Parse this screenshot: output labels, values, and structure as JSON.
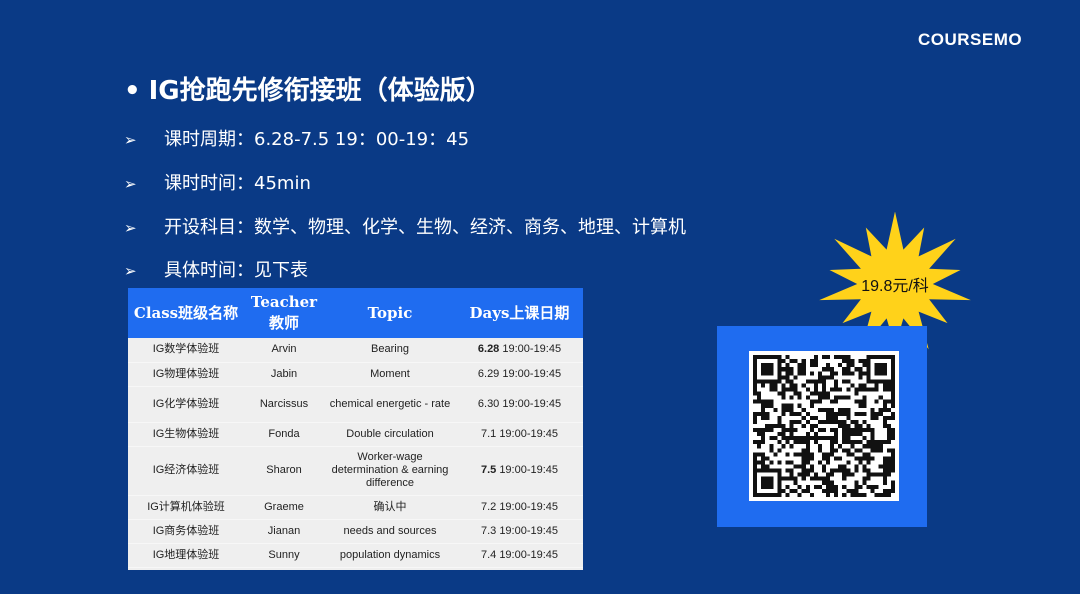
{
  "logo": {
    "text": "COURSEMO"
  },
  "title": {
    "bullet": "•",
    "text": "IG抢跑先修衔接班（体验版）"
  },
  "info": [
    {
      "arrow": "➢",
      "text": "课时周期：6.28-7.5 19：00-19：45"
    },
    {
      "arrow": "➢",
      "text": "课时时间：45min"
    },
    {
      "arrow": "➢",
      "text": "开设科目：数学、物理、化学、生物、经济、商务、地理、计算机"
    },
    {
      "arrow": "➢",
      "text": "具体时间：见下表"
    }
  ],
  "table": {
    "headers": [
      "Class班级名称",
      "Teacher教师",
      "Topic",
      "Days上课日期"
    ],
    "rows": [
      {
        "cls": "IG数学体验班",
        "teacher": "Arvin",
        "topic": "Bearing",
        "date": "6.28",
        "time": "19:00-19:45",
        "date_bold": true
      },
      {
        "cls": "IG物理体验班",
        "teacher": "Jabin",
        "topic": "Moment",
        "date": "6.29",
        "time": "19:00-19:45",
        "date_bold": false
      },
      {
        "cls": "IG化学体验班",
        "teacher": "Narcissus",
        "topic": "chemical energetic - rate",
        "date": "6.30",
        "time": "19:00-19:45",
        "date_bold": false
      },
      {
        "cls": "IG生物体验班",
        "teacher": "Fonda",
        "topic": "Double circulation",
        "date": "7.1",
        "time": "19:00-19:45",
        "date_bold": false
      },
      {
        "cls": "IG经济体验班",
        "teacher": "Sharon",
        "topic": "Worker-wage determination & earning difference",
        "date": "7.5",
        "time": "19:00-19:45",
        "date_bold": true
      },
      {
        "cls": "IG计算机体验班",
        "teacher": "Graeme",
        "topic": "确认中",
        "date": "7.2",
        "time": "19:00-19:45",
        "date_bold": false
      },
      {
        "cls": "IG商务体验班",
        "teacher": "Jianan",
        "topic": "needs and sources",
        "date": "7.3",
        "time": "19:00-19:45",
        "date_bold": false
      },
      {
        "cls": "IG地理体验班",
        "teacher": "Sunny",
        "topic": "population dynamics",
        "date": "7.4",
        "time": "19:00-19:45",
        "date_bold": false
      }
    ]
  },
  "promo": {
    "price": "19.8元/科"
  },
  "qr": {
    "icon": "qr-code-icon"
  },
  "colors": {
    "background": "#0a3a86",
    "accent": "#1f6cf0",
    "burst": "#ffd21a"
  }
}
